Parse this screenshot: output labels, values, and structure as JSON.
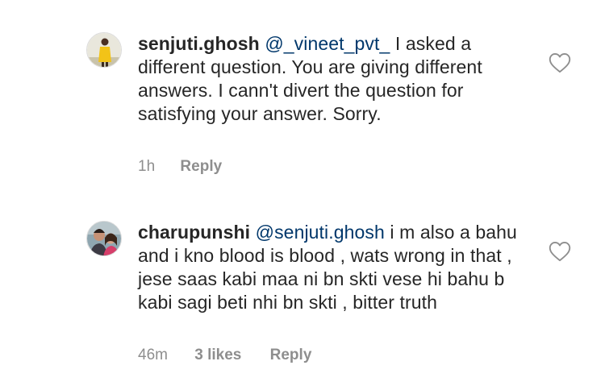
{
  "comments": [
    {
      "username": "senjuti.ghosh",
      "mention": "@_vineet_pvt_",
      "text": "I asked a different question. You are giving different answers. I cann't divert the question for satisfying your answer. Sorry.",
      "time": "1h",
      "reply_label": "Reply",
      "avatar_icon": "avatar-photo-yellow-dress",
      "like_icon": "heart-outline-icon"
    },
    {
      "username": "charupunshi",
      "mention": "@senjuti.ghosh",
      "text": "i m also a bahu and i kno blood is blood , wats wrong in that , jese saas kabi maa ni bn skti vese hi bahu b kabi sagi beti nhi bn skti , bitter truth",
      "time": "46m",
      "likes": "3 likes",
      "reply_label": "Reply",
      "avatar_icon": "avatar-photo-couple",
      "like_icon": "heart-outline-icon"
    }
  ],
  "colors": {
    "text": "#262626",
    "mention": "#00376b",
    "meta": "#8e8e8e"
  }
}
